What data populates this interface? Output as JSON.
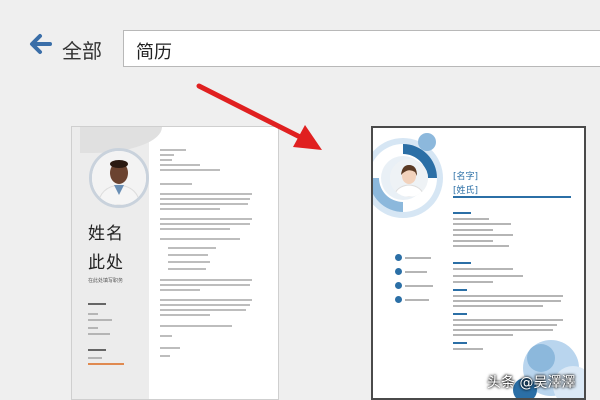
{
  "header": {
    "back_icon": "back-arrow-icon",
    "scope_label": "全部",
    "search_value": "简历",
    "accent_color": "#3a6ea8"
  },
  "annotation": {
    "icon": "red-pointer-arrow",
    "color": "#e02020"
  },
  "templates": [
    {
      "name_line1": "姓名",
      "name_line2": "此处",
      "tagline": "在此处填写职务"
    },
    {
      "name_line1": "[名字]",
      "name_line2": "[姓氏]",
      "accent_color": "#2b6fa6"
    }
  ],
  "watermark": "头条 @吴澤澤"
}
